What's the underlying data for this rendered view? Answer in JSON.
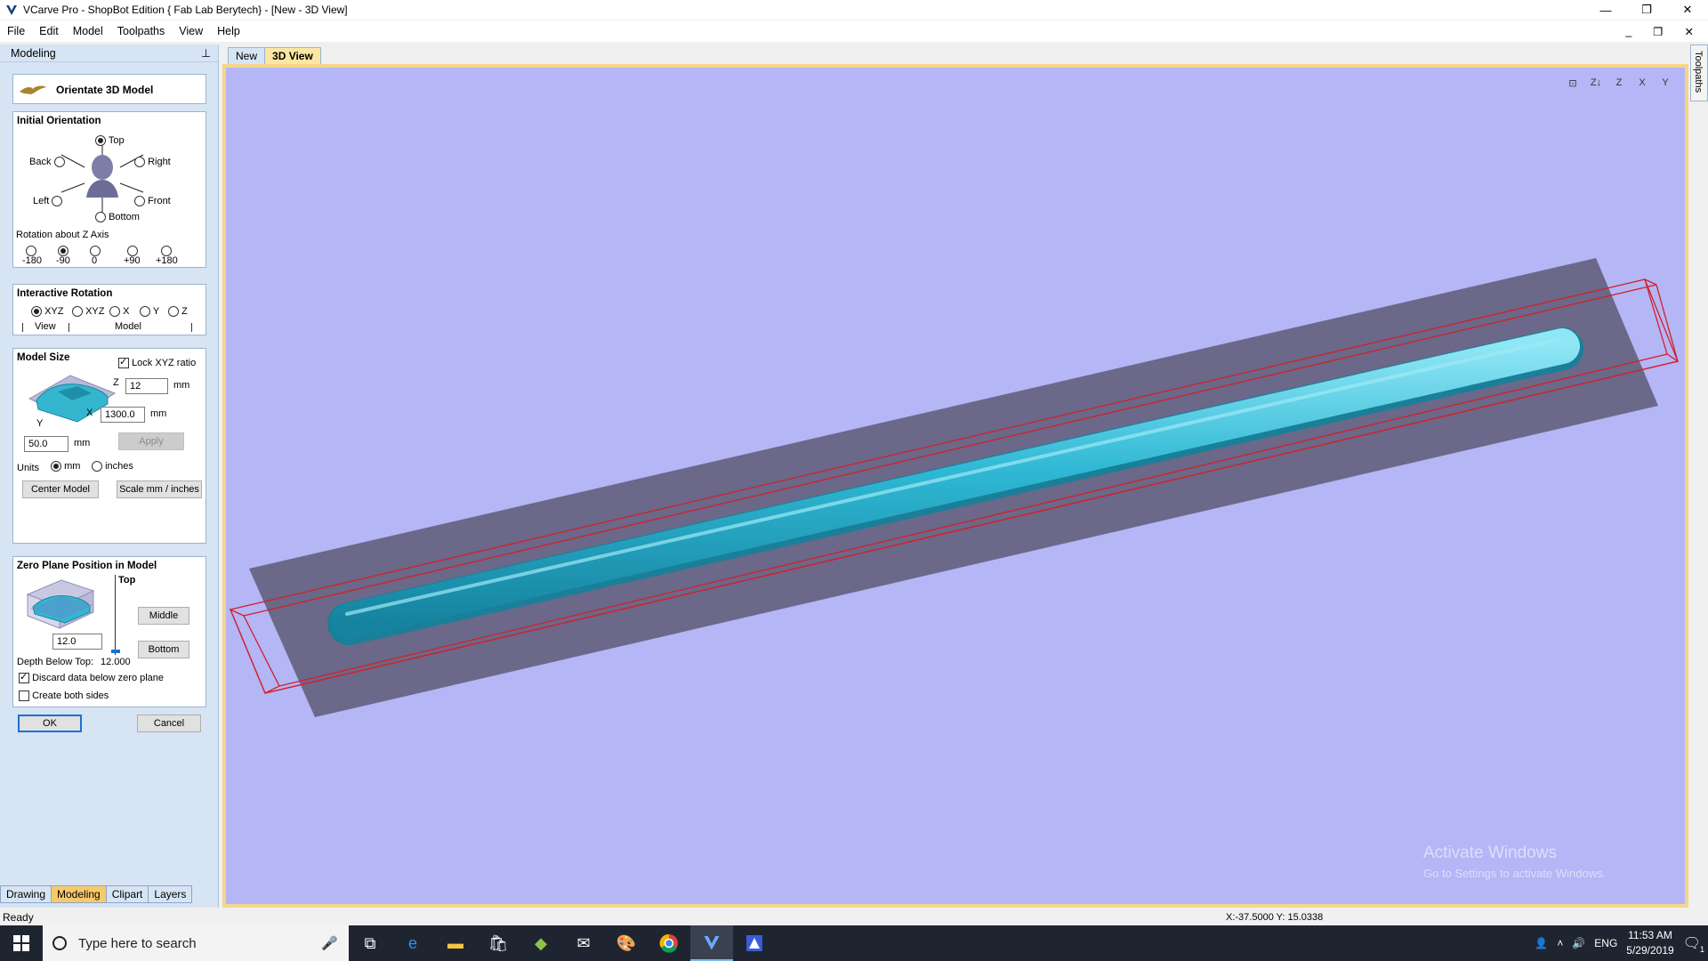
{
  "window": {
    "title": "VCarve Pro - ShopBot Edition { Fab Lab Berytech} - [New - 3D View]",
    "minimize": "—",
    "restore": "❐",
    "close": "✕"
  },
  "menu": [
    "File",
    "Edit",
    "Model",
    "Toolpaths",
    "View",
    "Help"
  ],
  "mdi_controls": [
    "_",
    "❐",
    "✕"
  ],
  "panel": {
    "title": "Modeling",
    "pin": "⊥",
    "header_title": "Orientate 3D Model",
    "initial_orientation": {
      "title": "Initial Orientation",
      "top": "Top",
      "back": "Back",
      "right": "Right",
      "left": "Left",
      "front": "Front",
      "bottom": "Bottom",
      "selected": "Top"
    },
    "rotation_z": {
      "title": "Rotation about Z Axis",
      "options": [
        "-180",
        "-90",
        "0",
        "+90",
        "+180"
      ],
      "selected": "-90"
    },
    "interactive_rotation": {
      "title": "Interactive Rotation",
      "options": [
        "XYZ",
        "XYZ",
        "X",
        "Y",
        "Z"
      ],
      "selected": "XYZ",
      "view_label": "View",
      "model_label": "Model"
    },
    "model_size": {
      "title": "Model Size",
      "lock_label": "Lock XYZ ratio",
      "lock_checked": true,
      "z_label": "Z",
      "z_value": "12",
      "x_label": "X",
      "x_value": "1300.0",
      "y_label": "Y",
      "y_value": "50.0",
      "unit": "mm",
      "apply": "Apply",
      "units_label": "Units",
      "unit_mm": "mm",
      "unit_inches": "inches",
      "center_model": "Center Model",
      "scale": "Scale mm / inches"
    },
    "zero_plane": {
      "title": "Zero Plane Position in Model",
      "top": "Top",
      "middle": "Middle",
      "bottom": "Bottom",
      "value": "12.0",
      "depth_label": "Depth Below Top:",
      "depth_value": "12.000",
      "discard_label": "Discard data below zero plane",
      "discard_checked": true,
      "both_sides_label": "Create both sides",
      "both_sides_checked": false
    },
    "ok": "OK",
    "cancel": "Cancel",
    "tabs": [
      "Drawing",
      "Modeling",
      "Clipart",
      "Layers"
    ],
    "active_tab": "Modeling"
  },
  "doc_tabs": [
    "New",
    "3D View"
  ],
  "active_doc_tab": "3D View",
  "right_tab": "Toolpaths",
  "view_icons": [
    "⊡",
    "Z↓",
    "Z",
    "X",
    "Y"
  ],
  "watermark": {
    "line1": "Activate Windows",
    "line2": "Go to Settings to activate Windows."
  },
  "status": {
    "text": "Ready",
    "coords": "X:-37.5000 Y: 15.0338"
  },
  "taskbar": {
    "search_placeholder": "Type here to search",
    "lang": "ENG",
    "time": "11:53 AM",
    "date": "5/29/2019",
    "notif_count": "1"
  },
  "colors": {
    "viewport_bg": "#b4b6f6",
    "plate": "#6b6889",
    "model": "#2fb8d4",
    "bbox": "#d2202a",
    "active_tab": "#f8c96b"
  }
}
